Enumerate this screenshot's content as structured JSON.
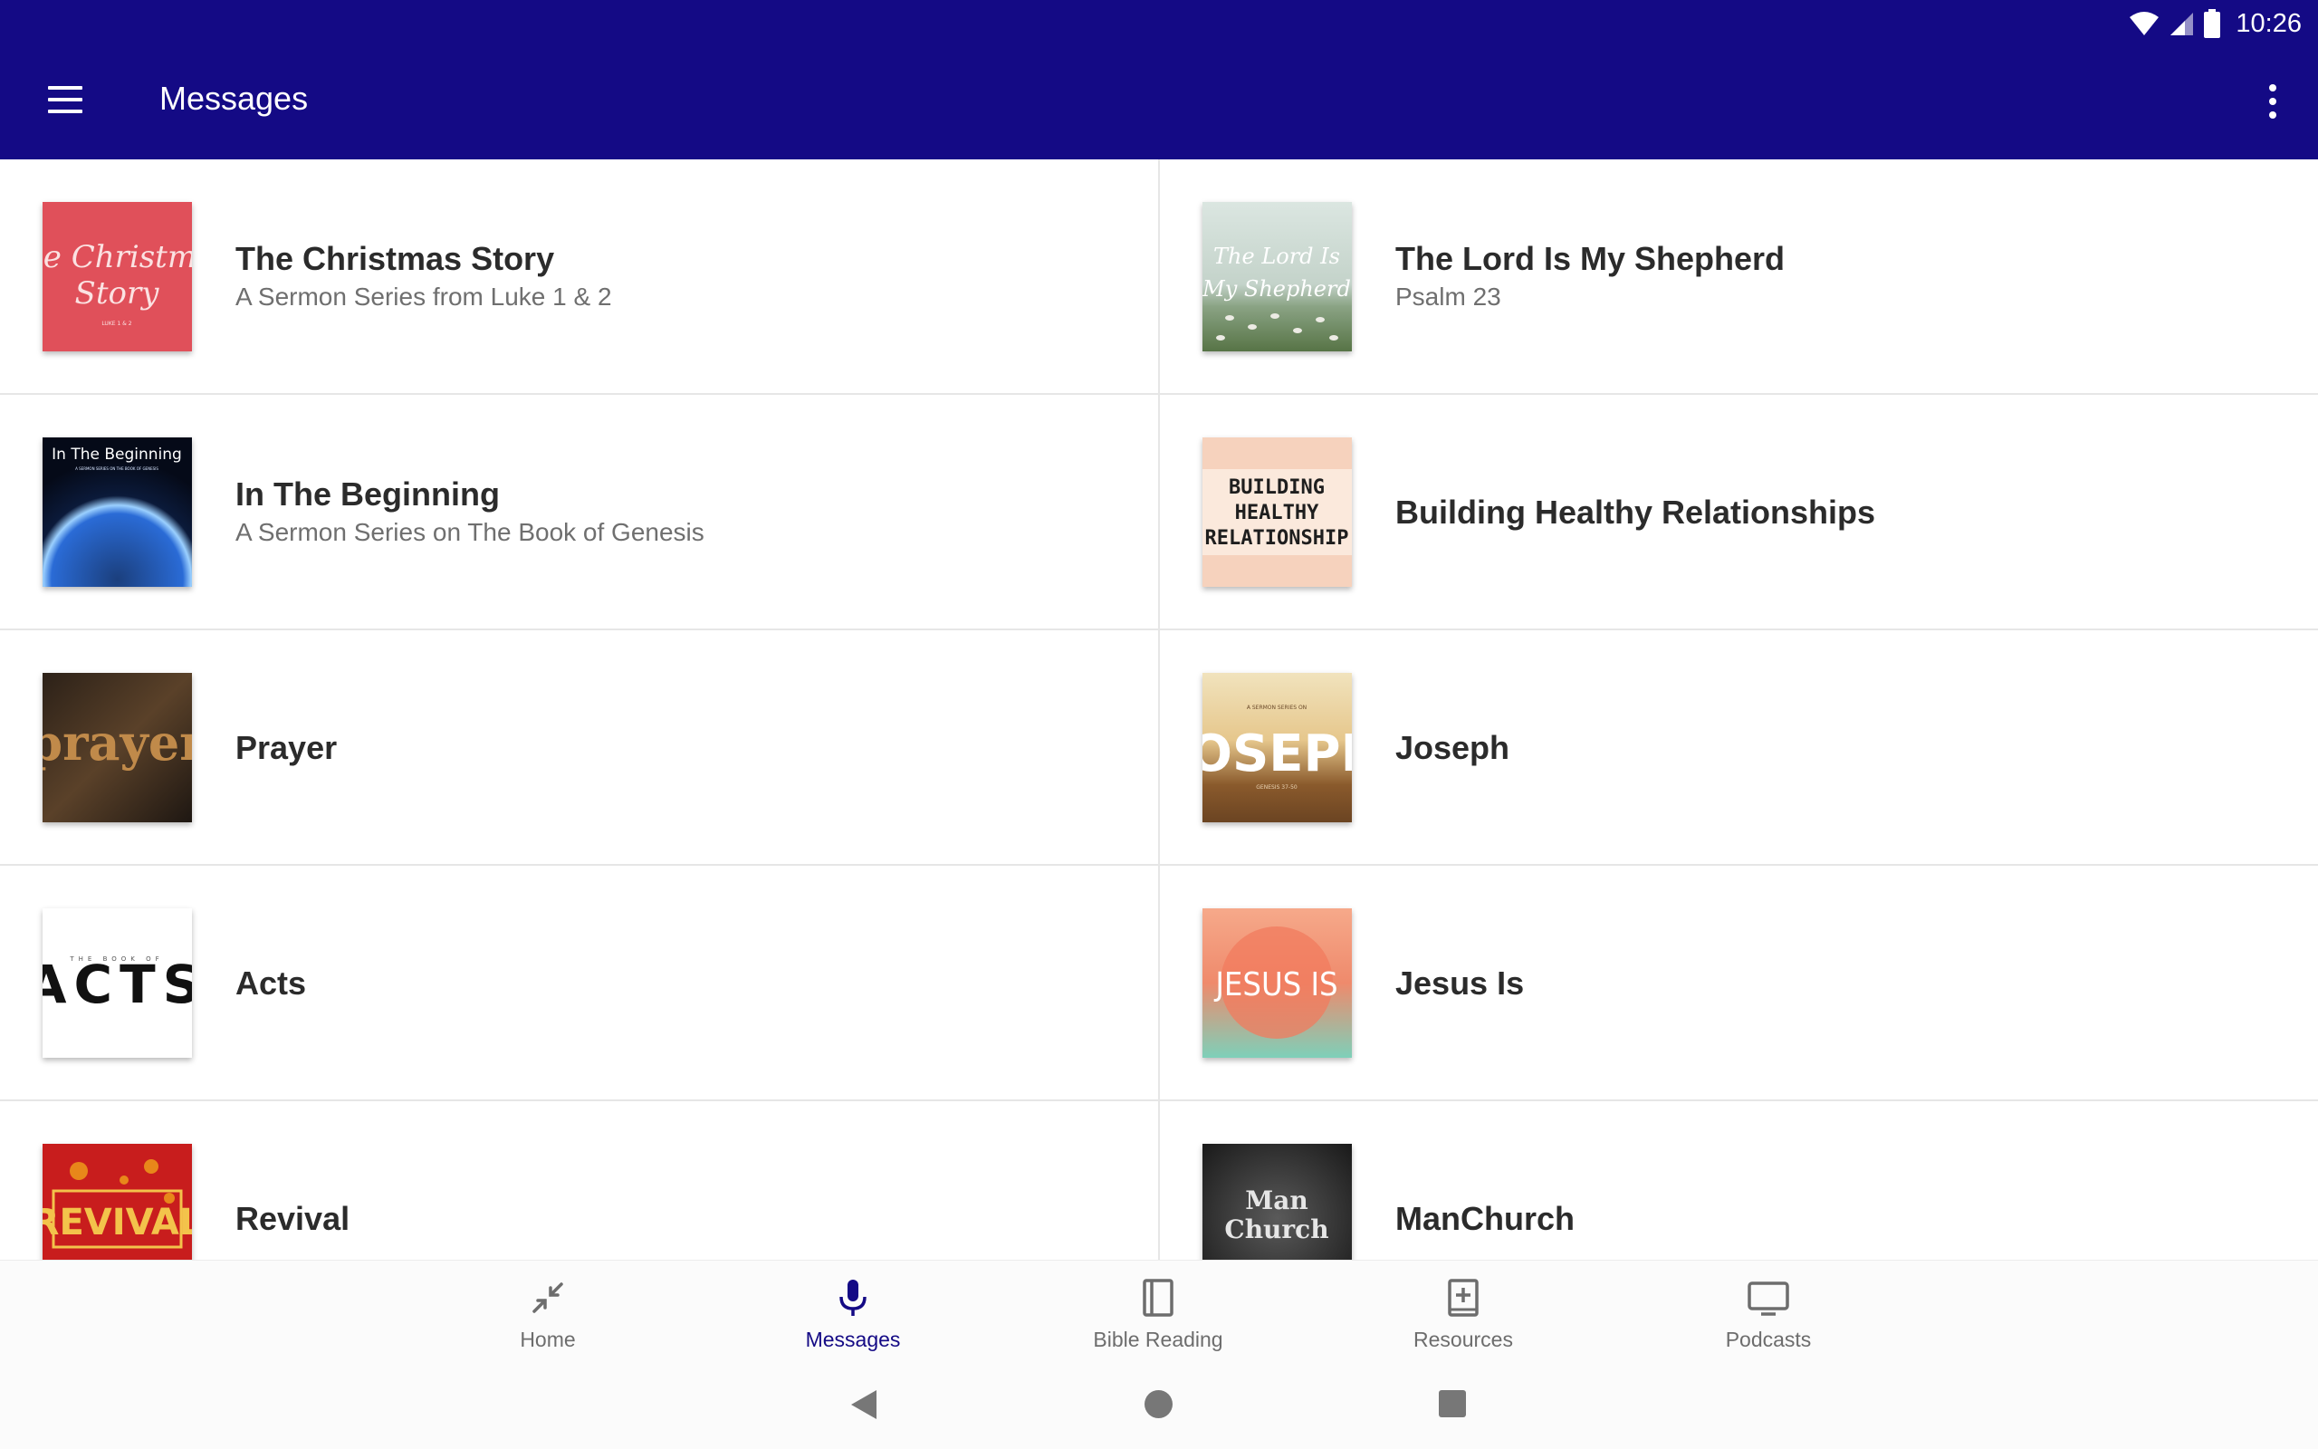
{
  "status_bar": {
    "time": "10:26",
    "icons": [
      "wifi-icon",
      "signal-icon",
      "battery-icon"
    ]
  },
  "app_bar": {
    "title": "Messages",
    "menu_icon": "hamburger-menu-icon",
    "more_icon": "more-vert-icon",
    "background": "#140a85"
  },
  "series": [
    {
      "title": "The Christmas Story",
      "subtitle": "A Sermon Series from Luke 1 & 2",
      "art_text": [
        "The Christmas",
        "Story",
        "LUKE 1 & 2"
      ]
    },
    {
      "title": "The Lord Is My Shepherd",
      "subtitle": "Psalm 23",
      "art_text": [
        "The Lord Is",
        "My Shepherd"
      ]
    },
    {
      "title": "In The Beginning",
      "subtitle": "A Sermon Series on The Book of Genesis",
      "art_text": [
        "In The Beginning",
        "A SERMON SERIES ON THE BOOK OF GENESIS"
      ]
    },
    {
      "title": "Building Healthy Relationships",
      "subtitle": "",
      "art_text": [
        "BUILDING",
        "HEALTHY",
        "RELATIONSHIP"
      ]
    },
    {
      "title": "Prayer",
      "subtitle": "",
      "art_text": [
        "prayer"
      ]
    },
    {
      "title": "Joseph",
      "subtitle": "",
      "art_text": [
        "A SERMON SERIES ON",
        "JOSEPH",
        "GENESIS 37-50"
      ]
    },
    {
      "title": "Acts",
      "subtitle": "",
      "art_text": [
        "THE BOOK OF",
        "ACTS"
      ]
    },
    {
      "title": "Jesus Is",
      "subtitle": "",
      "art_text": [
        "JESUS IS"
      ]
    },
    {
      "title": "Revival",
      "subtitle": "",
      "art_text": [
        "REVIVAL"
      ]
    },
    {
      "title": "ManChurch",
      "subtitle": "",
      "art_text": [
        "Man",
        "Church"
      ]
    }
  ],
  "bottom_nav": {
    "items": [
      {
        "label": "Home",
        "icon": "collapse-arrows-icon",
        "active": false
      },
      {
        "label": "Messages",
        "icon": "microphone-icon",
        "active": true
      },
      {
        "label": "Bible Reading",
        "icon": "book-icon",
        "active": false
      },
      {
        "label": "Resources",
        "icon": "add-book-icon",
        "active": false
      },
      {
        "label": "Podcasts",
        "icon": "monitor-icon",
        "active": false
      }
    ],
    "active_color": "#140a85",
    "inactive_color": "#6d6d6d"
  },
  "system_nav": {
    "icons": [
      "back-icon",
      "home-icon",
      "recents-icon"
    ]
  }
}
